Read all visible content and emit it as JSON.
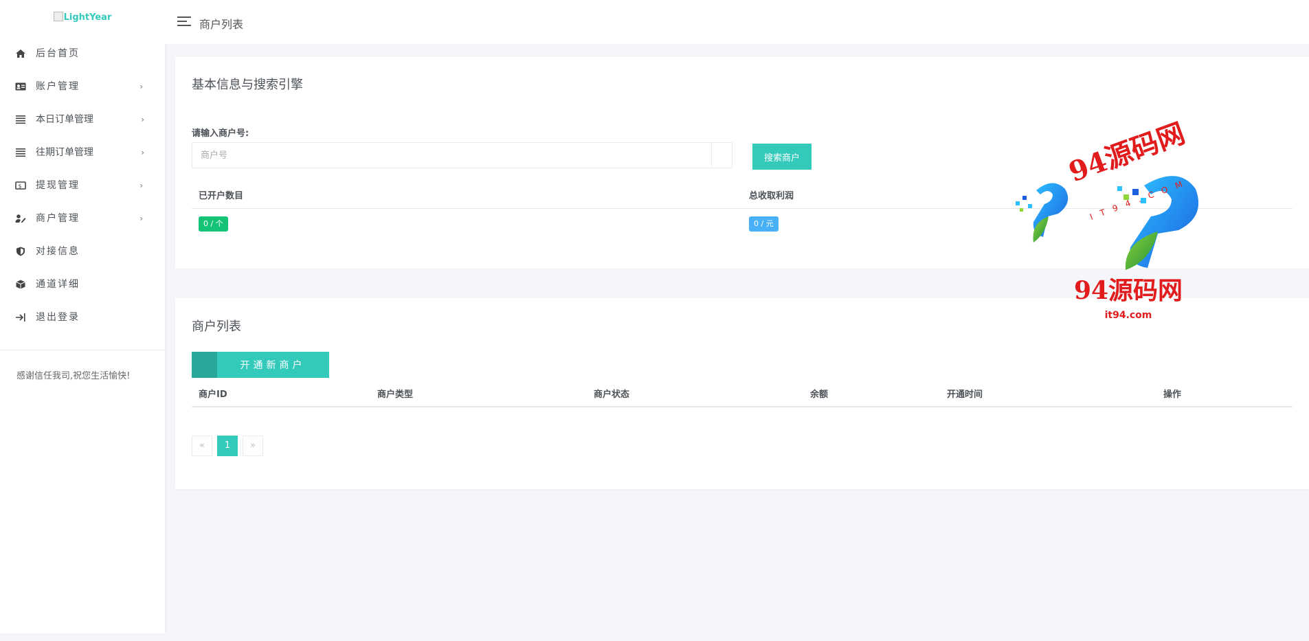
{
  "sidebar": {
    "logo_alt": "LightYear",
    "items": [
      {
        "label": "后台首页",
        "icon": "home-icon",
        "has_submenu": false
      },
      {
        "label": "账户管理",
        "icon": "id-card-icon",
        "has_submenu": true
      },
      {
        "label": "本日订单管理",
        "icon": "list-icon",
        "has_submenu": true
      },
      {
        "label": "往期订单管理",
        "icon": "list-icon",
        "has_submenu": true
      },
      {
        "label": "提现管理",
        "icon": "money-icon",
        "has_submenu": true
      },
      {
        "label": "商户管理",
        "icon": "user-edit-icon",
        "has_submenu": true
      },
      {
        "label": "对接信息",
        "icon": "shield-icon",
        "has_submenu": false
      },
      {
        "label": "通道详细",
        "icon": "cube-icon",
        "has_submenu": false
      },
      {
        "label": "退出登录",
        "icon": "logout-icon",
        "has_submenu": false
      }
    ],
    "note": "感谢信任我司,祝您生活愉快!"
  },
  "header": {
    "title": "商户列表"
  },
  "info_card": {
    "title": "基本信息与搜索引擎",
    "search_label": "请输入商户号:",
    "search_placeholder": "商户号",
    "search_button": "搜索商户",
    "stats": [
      {
        "label": "已开户数目",
        "value": "0 / 个",
        "color": "#15c377"
      },
      {
        "label": "总收取利润",
        "value": "0 / 元",
        "color": "#48b0f7"
      }
    ]
  },
  "list_card": {
    "title": "商户列表",
    "open_button": "开通新商户",
    "columns": [
      "商户ID",
      "商户类型",
      "商户状态",
      "余额",
      "开通时间",
      "操作"
    ],
    "rows": [],
    "pagination": {
      "prev": "«",
      "pages": [
        "1"
      ],
      "current": "1",
      "next": "»"
    }
  },
  "watermark": {
    "brand": "94源码网",
    "sub": "IT94.COM",
    "domain": "it94.com"
  },
  "colors": {
    "accent": "#33cabb",
    "success": "#15c377",
    "info": "#48b0f7",
    "watermark_red": "#e21c1c"
  }
}
